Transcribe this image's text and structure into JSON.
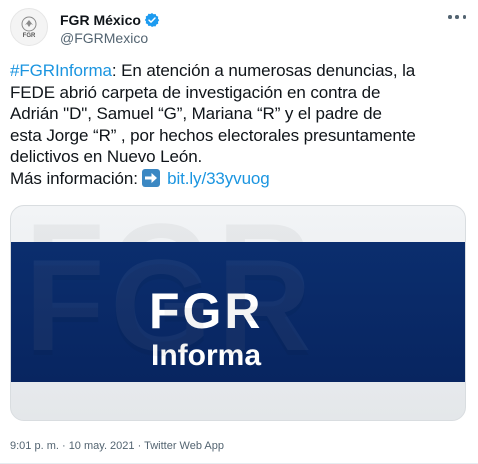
{
  "author": {
    "display_name": "FGR México",
    "handle": "@FGRMexico",
    "avatar_label": "FGR",
    "verified": true
  },
  "tweet": {
    "lines": [
      {
        "hashtag": "#FGRInforma",
        "text": ": En atención a numerosas denuncias, la"
      },
      {
        "text": "FEDE abrió carpeta de investigación en contra de"
      },
      {
        "text": "Adrián \"D\",  Samuel “G”, Mariana “R” y el padre de"
      },
      {
        "text": "esta Jorge “R” , por hechos electorales presuntamente"
      },
      {
        "text": "delictivos en Nuevo León."
      },
      {
        "prefix": "Más información: ",
        "link": "bit.ly/33yvuog"
      }
    ]
  },
  "media": {
    "watermark": "FGR",
    "title": "FGR",
    "subtitle": "Informa"
  },
  "meta": {
    "timestamp": "9:01 p. m. · 10 may. 2021 · Twitter Web App"
  },
  "colors": {
    "link": "#1b95e0",
    "verified": "#1d9bf0",
    "band": "#0b2e6e"
  },
  "icons": {
    "verified": "verified-badge-icon",
    "more": "more-options-icon",
    "arrow": "right-arrow-emoji-icon"
  }
}
